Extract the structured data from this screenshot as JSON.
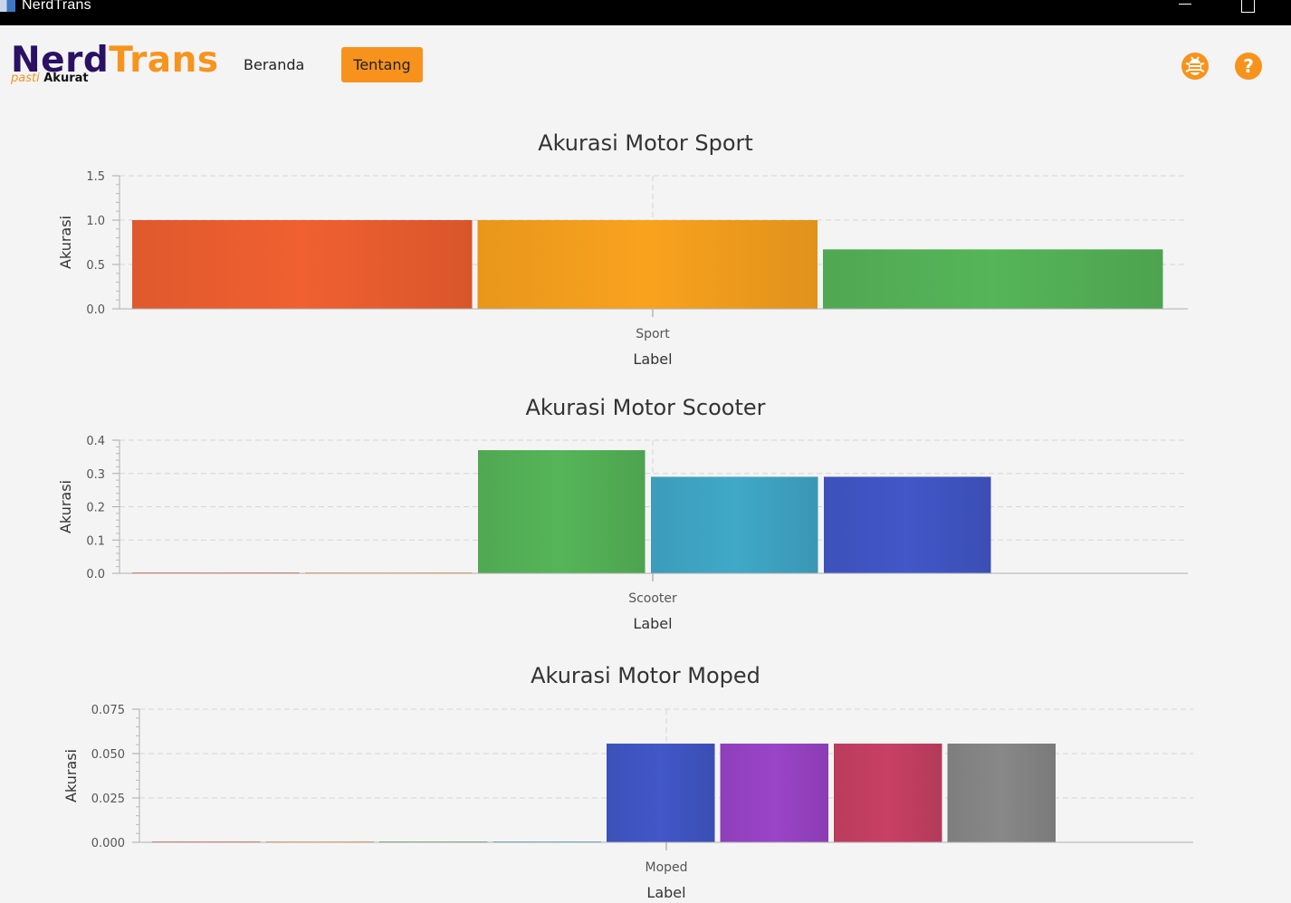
{
  "window": {
    "title": "NerdTrans"
  },
  "header": {
    "logo_part1": "Nerd",
    "logo_part2": "Trans",
    "tagline_part1": "pasti",
    "tagline_part2": "Akurat",
    "nav": [
      {
        "label": "Beranda",
        "active": false
      },
      {
        "label": "Tentang",
        "active": true
      }
    ],
    "icons": [
      "bug-icon",
      "help-icon"
    ],
    "help_glyph": "?",
    "accent_color": "#f7931d",
    "brand_color": "#2a1163"
  },
  "chart_data": [
    {
      "type": "bar",
      "title": "Akurasi Motor Sport",
      "xlabel": "Label",
      "ylabel": "Akurasi",
      "categories": [
        "Sport"
      ],
      "ylim": [
        0,
        1.5
      ],
      "yticks": [
        "0.0",
        "0.5",
        "1.0",
        "1.5"
      ],
      "grid": true,
      "series": [
        {
          "values": [
            1.0
          ],
          "color": "#f06030"
        },
        {
          "values": [
            1.0
          ],
          "color": "#f9a21e"
        },
        {
          "values": [
            0.67
          ],
          "color": "#56b558"
        }
      ]
    },
    {
      "type": "bar",
      "title": "Akurasi Motor Scooter",
      "xlabel": "Label",
      "ylabel": "Akurasi",
      "categories": [
        "Scooter"
      ],
      "ylim": [
        0,
        0.4
      ],
      "yticks": [
        "0.0",
        "0.1",
        "0.2",
        "0.3",
        "0.4"
      ],
      "grid": true,
      "series": [
        {
          "values": [
            0.0
          ],
          "color": "#f06030"
        },
        {
          "values": [
            0.0
          ],
          "color": "#f9a21e"
        },
        {
          "values": [
            0.37
          ],
          "color": "#56b558"
        },
        {
          "values": [
            0.29
          ],
          "color": "#40a8c8"
        },
        {
          "values": [
            0.29
          ],
          "color": "#4257c8"
        }
      ]
    },
    {
      "type": "bar",
      "title": "Akurasi Motor Moped",
      "xlabel": "Label",
      "ylabel": "Akurasi",
      "categories": [
        "Moped"
      ],
      "ylim": [
        0,
        0.075
      ],
      "yticks": [
        "0.000",
        "0.025",
        "0.050",
        "0.075"
      ],
      "grid": true,
      "series": [
        {
          "values": [
            0.0
          ],
          "color": "#f06030"
        },
        {
          "values": [
            0.0
          ],
          "color": "#f9a21e"
        },
        {
          "values": [
            0.0
          ],
          "color": "#56b558"
        },
        {
          "values": [
            0.0
          ],
          "color": "#40a8c8"
        },
        {
          "values": [
            0.0556
          ],
          "color": "#4257c8"
        },
        {
          "values": [
            0.0556
          ],
          "color": "#9a44c8"
        },
        {
          "values": [
            0.0556
          ],
          "color": "#c84064"
        },
        {
          "values": [
            0.0556
          ],
          "color": "#888888"
        }
      ]
    }
  ]
}
